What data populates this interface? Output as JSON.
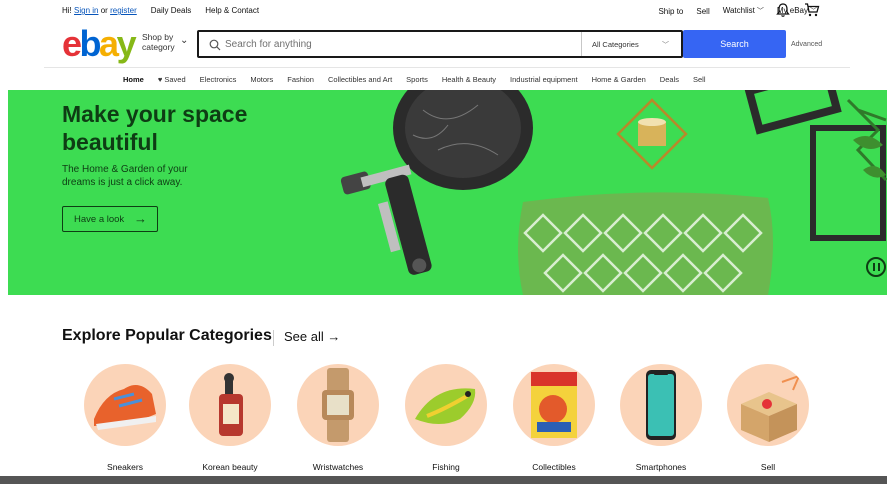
{
  "topbar": {
    "greeting": "Hi!",
    "sign_in": "Sign in",
    "or": "or",
    "register": "register",
    "daily_deals": "Daily Deals",
    "help_contact": "Help & Contact",
    "ship_to": "Ship to",
    "sell": "Sell",
    "watchlist": "Watchlist",
    "my_ebay": "My eBay"
  },
  "header": {
    "logo": [
      "e",
      "b",
      "a",
      "y"
    ],
    "shop_by_line1": "Shop by",
    "shop_by_line2": "category",
    "search_placeholder": "Search for anything",
    "category_select": "All Categories",
    "search_button": "Search",
    "advanced": "Advanced"
  },
  "nav": {
    "items": [
      {
        "label": "Home",
        "active": true
      },
      {
        "label": "♥ Saved"
      },
      {
        "label": "Electronics"
      },
      {
        "label": "Motors"
      },
      {
        "label": "Fashion"
      },
      {
        "label": "Collectibles and Art"
      },
      {
        "label": "Sports"
      },
      {
        "label": "Health & Beauty"
      },
      {
        "label": "Industrial equipment"
      },
      {
        "label": "Home & Garden"
      },
      {
        "label": "Deals"
      },
      {
        "label": "Sell"
      }
    ]
  },
  "hero": {
    "title": "Make your space beautiful",
    "subtitle": "The Home & Garden of your dreams is just a click away.",
    "cta": "Have a look",
    "bg_color": "#3ddc52"
  },
  "explore": {
    "title": "Explore Popular Categories",
    "see_all": "See all",
    "categories": [
      {
        "label": "Sneakers"
      },
      {
        "label": "Korean beauty"
      },
      {
        "label": "Wristwatches"
      },
      {
        "label": "Fishing"
      },
      {
        "label": "Collectibles"
      },
      {
        "label": "Smartphones"
      },
      {
        "label": "Sell"
      }
    ]
  }
}
